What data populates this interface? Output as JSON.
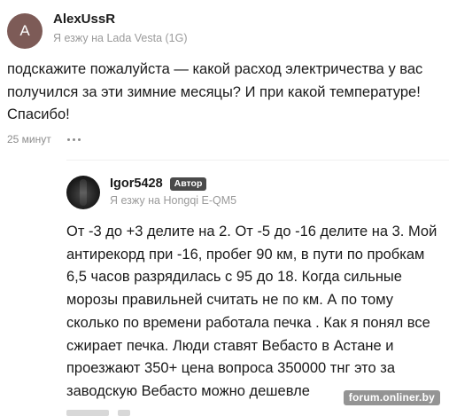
{
  "comment": {
    "avatar_letter": "A",
    "author": "AlexUssR",
    "car": "Я езжу на Lada Vesta (1G)",
    "text": "подскажите пожалуйста — какой расход электричества у вас получился за эти зимние месяцы? И при какой температуре! Спасибо!",
    "time": "25 минут",
    "more_icon": "more-dots-icon"
  },
  "reply": {
    "author": "Igor5428",
    "badge": "Автор",
    "car": "Я езжу на Hongqi E-QM5",
    "text": "От -3 до +3 делите на 2. От -5 до -16 делите на 3. Мой антирекорд при -16, пробег 90 км, в пути по пробкам 6,5 часов разрядилась с 95 до 18. Когда сильные морозы правильней считать не по км. А по тому сколько по времени работала печка . Как я понял все сжирает печка. Люди ставят Вебасто в Астане и проезжают 350+ цена вопроса 350000 тнг это за заводскую Вебасто можно дешевле"
  },
  "watermark": "forum.onliner.by",
  "colors": {
    "avatar_a_bg": "#7d5b57",
    "badge_bg": "#4a4a4a",
    "muted_text": "#9a9a9a"
  }
}
